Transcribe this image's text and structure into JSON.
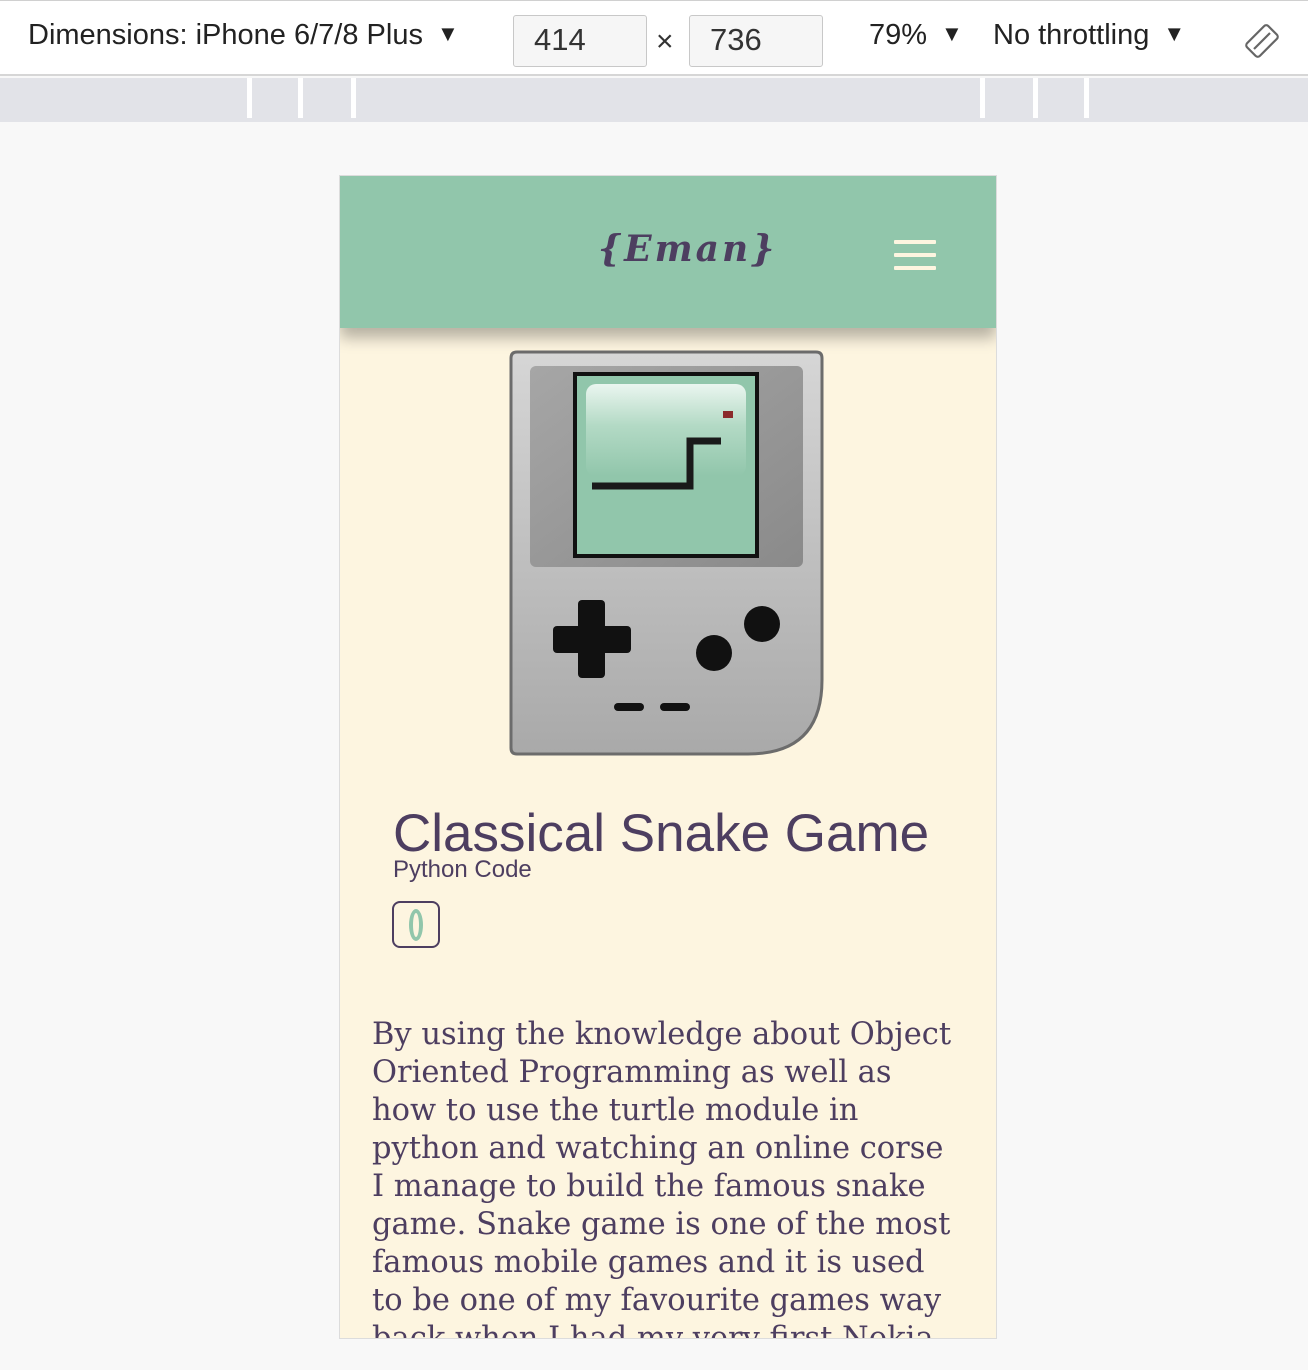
{
  "devtools": {
    "dimensions_label": "Dimensions: iPhone 6/7/8 Plus",
    "width_value": "414",
    "times_sign": "×",
    "height_value": "736",
    "zoom_label": "79%",
    "throttle_label": "No throttling",
    "caret": "▼",
    "icons": {
      "dropdown": "caret-down-icon",
      "rotate": "rotate-device-icon"
    }
  },
  "site": {
    "logo": "{Eman}",
    "menu_icon": "hamburger-menu-icon",
    "hero_image": "gameboy-snake-illustration",
    "project": {
      "title": "Classical Snake Game",
      "subtitle": "Python Code",
      "code_link_icon": "code-link-icon",
      "description": "By using the knowledge about Object Oriented Programming as well as how to use the turtle module in python and watching an online corse I manage to build the famous snake game. Snake game is one of the most famous mobile games and it is used to be one of my favourite games way back when I had my very first Nokia mobile phone I"
    }
  },
  "colors": {
    "nav_green": "#91c6ab",
    "cream": "#fdf5e0",
    "purple_text": "#4d3e60"
  }
}
